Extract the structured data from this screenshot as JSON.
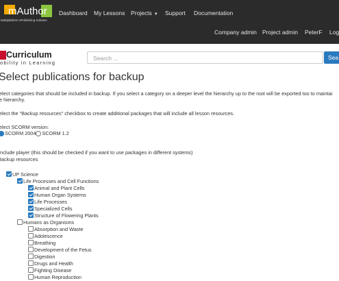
{
  "header": {
    "logo_text": "mAuthor",
    "logo_sub": "Multiplatform ePublishing Solution",
    "nav": [
      "Dashboard",
      "My Lessons",
      "Projects",
      "Support",
      "Documentation"
    ],
    "nav2": [
      "Company admin",
      "Project admin",
      "PeterF",
      "Logout"
    ]
  },
  "brand": {
    "name": "Curriculum",
    "tagline": "obility in Learning"
  },
  "search": {
    "placeholder": "Search ...",
    "button": "Sea"
  },
  "page": {
    "title": "Select publications for backup",
    "intro1": "elect categories that should be included in backup. If you select a category on a deeper level the hierarchy up to the root will be exported too to maintai",
    "intro1b": "e hierarchy.",
    "intro2": "elect the \"Backup resources\" checkbox to create additional packages that will include all lesson resources.",
    "scorm_label": "elect SCORM version:",
    "scorm_options": [
      "SCORM 2004",
      "SCORM 1.2"
    ],
    "include_player": "Include player (this should be checked if you want to use packages in different systems)",
    "backup_resources": "Backup resources"
  },
  "tree": [
    {
      "label": "UP Science",
      "checked": true,
      "level": 0
    },
    {
      "label": "Life Processes and Cell Functions",
      "checked": true,
      "level": 1
    },
    {
      "label": "Animal and Plant Cells",
      "checked": true,
      "level": 2
    },
    {
      "label": "Human Organ Systems",
      "checked": true,
      "level": 2
    },
    {
      "label": "Life Processes",
      "checked": true,
      "level": 2
    },
    {
      "label": "Specialized Cells",
      "checked": true,
      "level": 2
    },
    {
      "label": "Structure of Flowering Plants",
      "checked": true,
      "level": 2
    },
    {
      "label": "Humans as Organisms",
      "checked": false,
      "level": 1
    },
    {
      "label": "Absorption and Waste",
      "checked": false,
      "level": 2
    },
    {
      "label": "Adolescence",
      "checked": false,
      "level": 2
    },
    {
      "label": "Breathing",
      "checked": false,
      "level": 2
    },
    {
      "label": "Development of the Fetus",
      "checked": false,
      "level": 2
    },
    {
      "label": "Digestion",
      "checked": false,
      "level": 2
    },
    {
      "label": "Drugs and Health",
      "checked": false,
      "level": 2
    },
    {
      "label": "Fighting Disease",
      "checked": false,
      "level": 2
    },
    {
      "label": "Human Reproduction",
      "checked": false,
      "level": 2
    }
  ]
}
